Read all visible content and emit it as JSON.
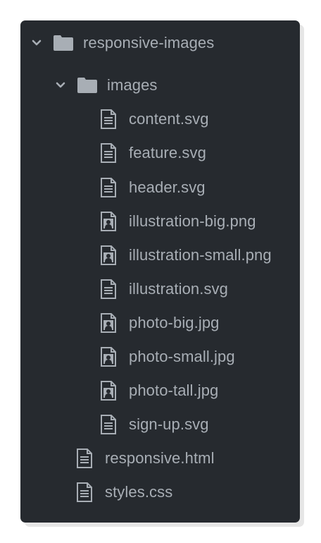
{
  "tree": {
    "root": {
      "label": "responsive-images",
      "chevron_icon": "chevron-down-icon",
      "icon": "folder-icon",
      "expanded": true
    },
    "images_folder": {
      "label": "images",
      "chevron_icon": "chevron-down-icon",
      "icon": "folder-icon",
      "expanded": true,
      "files": [
        {
          "label": "content.svg",
          "icon": "text-file-icon"
        },
        {
          "label": "feature.svg",
          "icon": "text-file-icon"
        },
        {
          "label": "header.svg",
          "icon": "text-file-icon"
        },
        {
          "label": "illustration-big.png",
          "icon": "image-file-icon"
        },
        {
          "label": "illustration-small.png",
          "icon": "image-file-icon"
        },
        {
          "label": "illustration.svg",
          "icon": "text-file-icon"
        },
        {
          "label": "photo-big.jpg",
          "icon": "image-file-icon"
        },
        {
          "label": "photo-small.jpg",
          "icon": "image-file-icon"
        },
        {
          "label": "photo-tall.jpg",
          "icon": "image-file-icon"
        },
        {
          "label": "sign-up.svg",
          "icon": "text-file-icon"
        }
      ]
    },
    "root_files": [
      {
        "label": "responsive.html",
        "icon": "text-file-icon"
      },
      {
        "label": "styles.css",
        "icon": "text-file-icon"
      }
    ]
  },
  "colors": {
    "panel_background": "#262a2f",
    "text": "#a8aeb5",
    "icon": "#a8aeb5"
  }
}
